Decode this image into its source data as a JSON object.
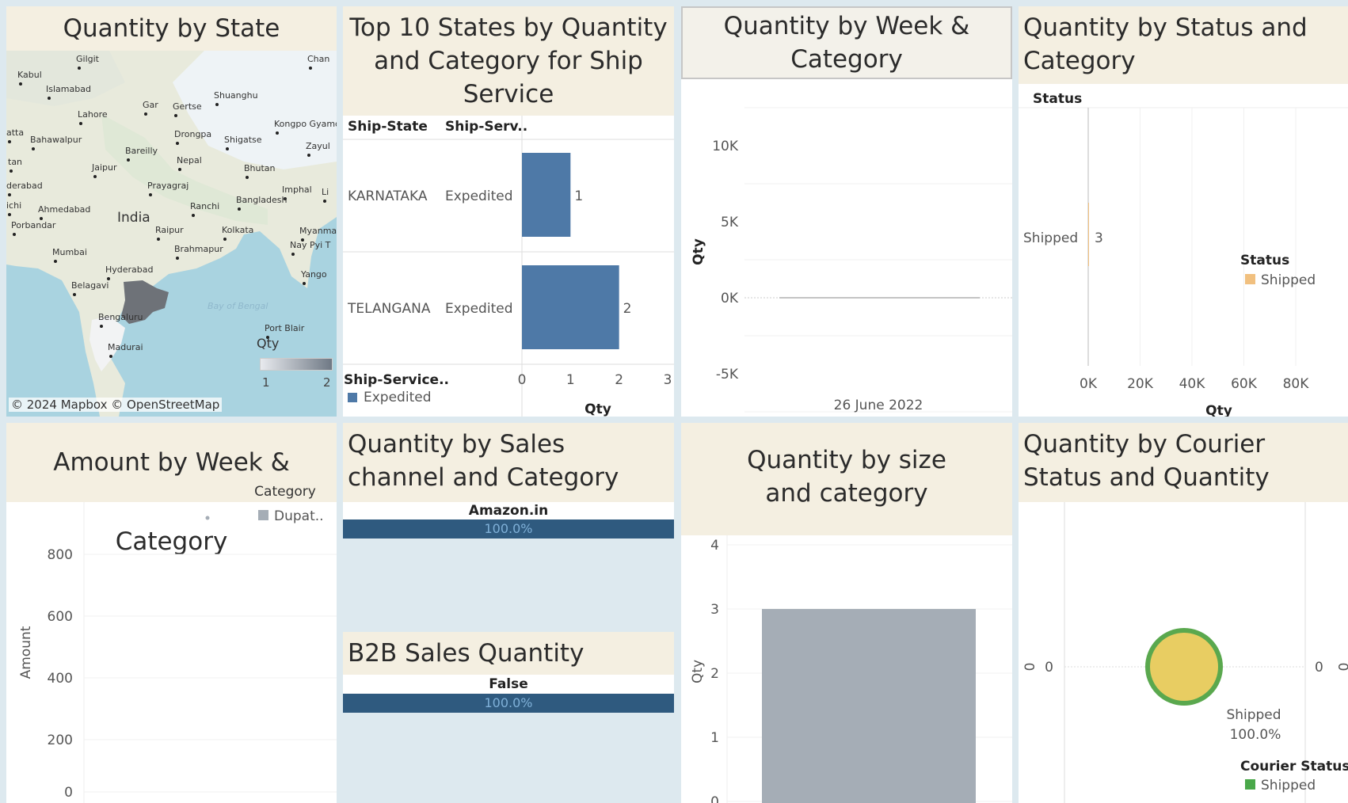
{
  "colors": {
    "bar": "#4e79a7",
    "sizebar": "#a5adb6",
    "shipped_legend": "#f1c07f",
    "courier_fill": "#e8cd62",
    "courier_ring": "#5aa84e",
    "courier_legend": "#4aa84a",
    "pct_bar": "#2f5a7f"
  },
  "map": {
    "title": "Quantity by State",
    "copyright": "© 2024 Mapbox © OpenStreetMap",
    "legend_title": "Qty",
    "legend_min": "1",
    "legend_max": "2",
    "places": [
      {
        "name": "Gilgit"
      },
      {
        "name": "Kabul"
      },
      {
        "name": "Islamabad"
      },
      {
        "name": "Lahore"
      },
      {
        "name": "Gar"
      },
      {
        "name": "Gertse"
      },
      {
        "name": "Shuanghu"
      },
      {
        "name": "Bahawalpur"
      },
      {
        "name": "Drongpa"
      },
      {
        "name": "Shigatse"
      },
      {
        "name": "Kongpo Gyamda"
      },
      {
        "name": "Bareilly"
      },
      {
        "name": "Nepal"
      },
      {
        "name": "Bhutan"
      },
      {
        "name": "Zayul"
      },
      {
        "name": "Jaipur"
      },
      {
        "name": "Prayagraj"
      },
      {
        "name": "Imphal"
      },
      {
        "name": "Ranchi"
      },
      {
        "name": "Bangladesh"
      },
      {
        "name": "Ahmedabad"
      },
      {
        "name": "India"
      },
      {
        "name": "Raipur"
      },
      {
        "name": "Kolkata"
      },
      {
        "name": "Porbandar"
      },
      {
        "name": "Brahmapur"
      },
      {
        "name": "Mumbai"
      },
      {
        "name": "Hyderabad"
      },
      {
        "name": "Nay Pyi T"
      },
      {
        "name": "Yango"
      },
      {
        "name": "Belagavi"
      },
      {
        "name": "Bengaluru"
      },
      {
        "name": "Bay of Bengal"
      },
      {
        "name": "Port Blair"
      },
      {
        "name": "Madurai"
      },
      {
        "name": "Chan"
      },
      {
        "name": "Myanma"
      },
      {
        "name": "tan"
      },
      {
        "name": "derabad"
      },
      {
        "name": "ichi"
      },
      {
        "name": "atta"
      },
      {
        "name": "Li"
      }
    ]
  },
  "top10": {
    "title": "Top 10 States by Quantity and Category for Ship Service",
    "col1": "Ship-State",
    "col2": "Ship-Serv..",
    "rows": [
      {
        "state": "KARNATAKA",
        "service": "Expedited",
        "label": "1"
      },
      {
        "state": "TELANGANA",
        "service": "Expedited",
        "label": "2"
      }
    ],
    "legend_title": "Ship-Service..",
    "legend_item": "Expedited",
    "axis_title": "Qty",
    "ticks": [
      "0",
      "1",
      "2",
      "3"
    ]
  },
  "week_cat": {
    "title": "Quantity by Week & Category",
    "ylabel": "Qty",
    "yticks": [
      "10K",
      "5K",
      "0K",
      "-5K"
    ],
    "xlabel": "26 June 2022"
  },
  "status_cat": {
    "title": "Quantity by Status and Category",
    "header": "Status",
    "row": "Shipped",
    "row_value": "3",
    "xticks": [
      "0K",
      "20K",
      "40K",
      "60K",
      "80K"
    ],
    "xlabel": "Qty",
    "legend_title": "Status",
    "legend_item": "Shipped"
  },
  "amount": {
    "title": "Amount by Week & Category",
    "ylabel": "Amount",
    "yticks": [
      "800",
      "600",
      "400",
      "200",
      "0"
    ],
    "legend_title": "Category",
    "legend_item": "Dupat.."
  },
  "channel": {
    "title": "Quantity by Sales channel and Category",
    "bar_label": "Amazon.in",
    "bar_pct": "100.0%"
  },
  "b2b": {
    "title": "B2B Sales Quantity",
    "bar_label": "False",
    "bar_pct": "100.0%"
  },
  "size": {
    "title": "Quantity by size and category",
    "ylabel": "Qty",
    "yticks": [
      "4",
      "3",
      "2",
      "1",
      "0"
    ]
  },
  "courier": {
    "title": "Quantity by Courier Status and Quantity",
    "left_axis": "0",
    "left_val": "0",
    "right_val": "0",
    "right_axis": "0",
    "bubble_label": "Shipped",
    "bubble_pct": "100.0%",
    "legend_title": "Courier Status",
    "legend_item": "Shipped"
  },
  "chart_data": [
    {
      "type": "bar",
      "title": "Top 10 States by Quantity and Category for Ship Service",
      "categories": [
        "KARNATAKA",
        "TELANGANA"
      ],
      "series": [
        {
          "name": "Expedited",
          "values": [
            1,
            2
          ]
        }
      ],
      "xlabel": "Qty",
      "xlim": [
        0,
        3
      ]
    },
    {
      "type": "line",
      "title": "Quantity by Week & Category",
      "x": [
        "26 June 2022"
      ],
      "ylabel": "Qty",
      "ylim": [
        -5000,
        10000
      ]
    },
    {
      "type": "bar",
      "title": "Quantity by Status and Category",
      "categories": [
        "Shipped"
      ],
      "series": [
        {
          "name": "Shipped",
          "values": [
            3
          ]
        }
      ],
      "xlabel": "Qty",
      "xlim": [
        0,
        80000
      ]
    },
    {
      "type": "line",
      "title": "Amount by Week & Category",
      "ylabel": "Amount",
      "ylim": [
        0,
        800
      ],
      "series": [
        {
          "name": "Dupat..",
          "values": []
        }
      ]
    },
    {
      "type": "bar",
      "title": "Quantity by Sales channel and Category",
      "categories": [
        "Amazon.in"
      ],
      "values": [
        100.0
      ]
    },
    {
      "type": "bar",
      "title": "B2B Sales Quantity",
      "categories": [
        "False"
      ],
      "values": [
        100.0
      ]
    },
    {
      "type": "bar",
      "title": "Quantity by size and category",
      "categories": [
        ""
      ],
      "values": [
        3
      ],
      "ylabel": "Qty",
      "ylim": [
        0,
        4
      ]
    },
    {
      "type": "scatter",
      "title": "Quantity by Courier Status and Quantity",
      "series": [
        {
          "name": "Shipped",
          "values": [
            100.0
          ]
        }
      ]
    }
  ]
}
